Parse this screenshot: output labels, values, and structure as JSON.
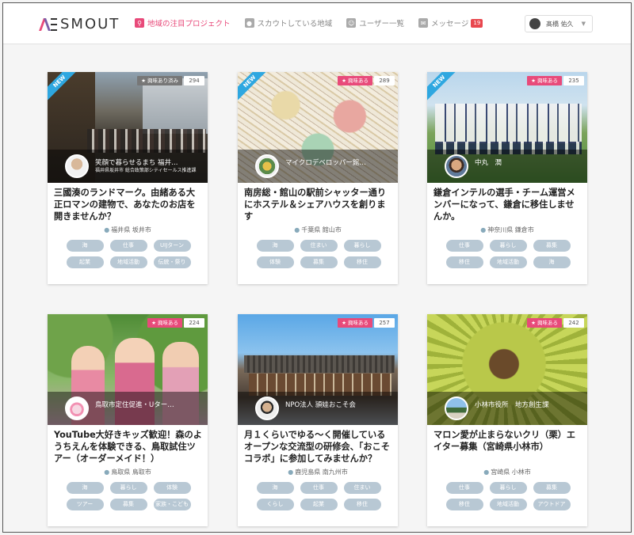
{
  "header": {
    "logo_text": "SMOUT",
    "nav": [
      {
        "label": "地域の注目プロジェクト",
        "icon": "search-icon",
        "active": true
      },
      {
        "label": "スカウトしている地域",
        "icon": "pin-icon",
        "active": false
      },
      {
        "label": "ユーザー一覧",
        "icon": "user-icon",
        "active": false
      },
      {
        "label": "メッセージ",
        "icon": "message-icon",
        "active": false,
        "badge": "19"
      }
    ],
    "user_name": "髙橋 佑久"
  },
  "cards": [
    {
      "is_new": true,
      "new_label": "NEW",
      "interest_label": "★ 興味あり済み",
      "interest_done": true,
      "count": "294",
      "org_name": "笑顔で暮らせるまち 福井…",
      "org_sub": "福井県坂井市 総合政策部シティセールス推進課",
      "title": "三國湊のランドマーク。由緒ある大正ロマンの建物で、あなたのお店を開きませんか？",
      "location": "福井県 坂井市",
      "tags": [
        "海",
        "仕事",
        "UIJターン",
        "起業",
        "地域活動",
        "伝統・祭り"
      ]
    },
    {
      "is_new": true,
      "new_label": "NEW",
      "interest_label": "★ 興味ある",
      "interest_done": false,
      "count": "289",
      "org_name": "マイクロデベロッパー館…",
      "org_sub": "",
      "title": "南房総・館山の駅前シャッター通りにホステル＆シェアハウスを創ります",
      "location": "千葉県 館山市",
      "tags": [
        "海",
        "住まい",
        "暮らし",
        "体験",
        "募集",
        "移住"
      ]
    },
    {
      "is_new": true,
      "new_label": "NEW",
      "interest_label": "★ 興味ある",
      "interest_done": false,
      "count": "235",
      "org_name": "中丸　潤",
      "org_sub": "",
      "title": "鎌倉インテルの選手・チーム運営メンバーになって、鎌倉に移住しませんか。",
      "location": "神奈川県 鎌倉市",
      "tags": [
        "仕事",
        "暮らし",
        "募集",
        "移住",
        "地域活動",
        "海"
      ]
    },
    {
      "is_new": false,
      "new_label": "",
      "interest_label": "★ 興味ある",
      "interest_done": false,
      "count": "224",
      "org_name": "鳥取市定住促進・Uター…",
      "org_sub": "",
      "title": "YouTube大好きキッズ歓迎！森のようちえんを体験できる、鳥取試住ツアー（オーダーメイド！）",
      "location": "鳥取県 鳥取市",
      "tags": [
        "海",
        "暮らし",
        "体験",
        "ツアー",
        "募集",
        "家族・こども"
      ]
    },
    {
      "is_new": false,
      "new_label": "",
      "interest_label": "★ 興味ある",
      "interest_done": false,
      "count": "257",
      "org_name": "NPO法人 頴娃おこそ会",
      "org_sub": "",
      "title": "月１くらいでゆる〜く開催しているオープンな交流型の研修会、「おこそコラボ」に参加してみませんか？",
      "location": "鹿児島県 南九州市",
      "tags": [
        "海",
        "仕事",
        "住まい",
        "くらし",
        "起業",
        "移住"
      ]
    },
    {
      "is_new": false,
      "new_label": "",
      "interest_label": "★ 興味ある",
      "interest_done": false,
      "count": "242",
      "org_name": "小林市役所　地方創生課",
      "org_sub": "",
      "title": "マロン愛が止まらないクリ（栗）エイター募集（宮崎県小林市）",
      "location": "宮崎県 小林市",
      "tags": [
        "仕事",
        "暮らし",
        "募集",
        "移住",
        "地域活動",
        "アウトドア"
      ]
    }
  ]
}
